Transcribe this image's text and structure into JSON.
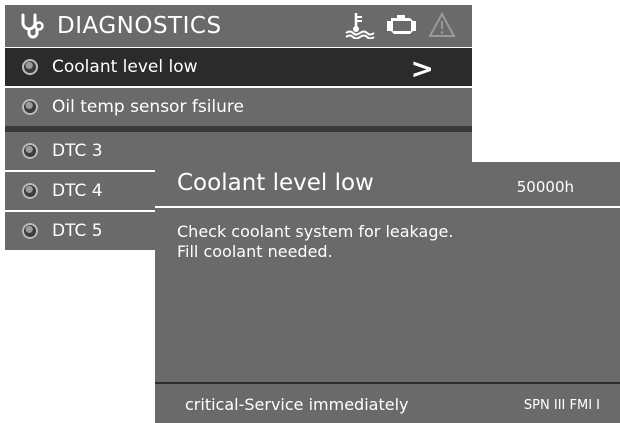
{
  "header": {
    "title": "DIAGNOSTICS",
    "icons": [
      "stethoscope-icon",
      "coolant-icon",
      "engine-icon",
      "warning-icon"
    ]
  },
  "list": {
    "items": [
      {
        "label": "Coolant level low",
        "selected": true
      },
      {
        "label": "Oil temp sensor fsilure",
        "selected": false
      },
      {
        "label": "DTC 3",
        "selected": false
      },
      {
        "label": "DTC 4",
        "selected": false
      },
      {
        "label": "DTC 5",
        "selected": false
      }
    ],
    "chevron": ">"
  },
  "popup": {
    "title": "Coolant level low",
    "hours": "50000h",
    "message": "Check coolant system for leakage.\nFill coolant needed.",
    "severity": "critical-Service immediately",
    "code": "SPN III FMI I"
  },
  "colors": {
    "panel": "#6a6a6a",
    "selected": "#2b2b2b",
    "text": "#ffffff"
  }
}
